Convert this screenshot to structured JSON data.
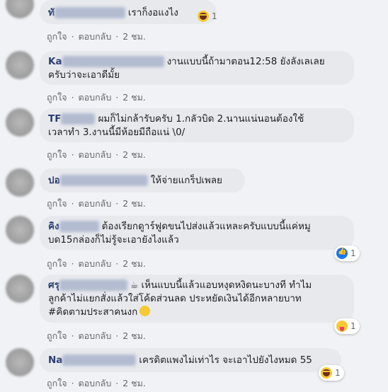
{
  "actions": {
    "like": "ถูกใจ",
    "reply": "ตอบกลับ",
    "sep": "·"
  },
  "comments": [
    {
      "name_prefix": "ทั",
      "lines": [
        "เราก็งอแงไง"
      ],
      "time": "2 ชม.",
      "reaction_count": "1"
    },
    {
      "name_prefix": "Ka",
      "lines": [
        "งานแบบนี้ถ้ามาตอน12:58 ยังลังเลเลย",
        "ครับว่าจะเอาดีมั้ย"
      ],
      "time": "2 ชม."
    },
    {
      "name_prefix": "TF",
      "lines": [
        "ผมก็ไม่กล้ารับครับ 1.กลัวบิด 2.นานแน่นอนต้องใช้",
        "เวลาทำ 3.งานนี้มีห้อยมีถือแน่ \\0/"
      ],
      "time": "2 ชม."
    },
    {
      "name_prefix": "ปอ",
      "lines": [
        "ให้จ่ายแกร็ปเพลย"
      ],
      "time": "2 ชม."
    },
    {
      "name_prefix": "คิง",
      "lines": [
        "ต้องเรียกดูาร์ฟูดขนไปส่งแล้วแหละครับแบบนี้แค่หมู",
        "บด15กล่องก็ไม่รู้จะเอายังไงแล้ว"
      ],
      "time": "2 ชม.",
      "reaction_count": "1"
    },
    {
      "name_prefix": "ศรุ",
      "lines": [
        "เห็นแบบนี้แล้วแอบหงุดหงิดนะบางที ทำไม",
        "ลูกค้าไม่แยกสั่งแล้วใส่โค้ดส่วนลด ประหยัดเงินได้อีกหลายบาท",
        "#คิดตามประสาคนงก"
      ],
      "time": "2 ชม.",
      "reaction_count": "1"
    },
    {
      "name_prefix": "Na",
      "lines": [
        "เครดิตแพงไม่เท่าไร จะเอาไปยังไงหมด 55"
      ],
      "time": "2 ชม.",
      "reaction_count": "1"
    }
  ]
}
